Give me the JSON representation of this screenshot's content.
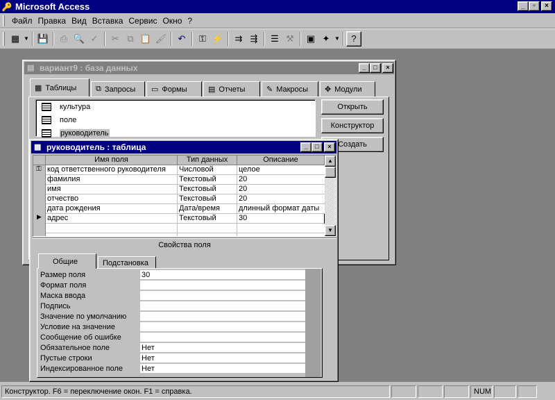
{
  "app": {
    "title": "Microsoft Access"
  },
  "menu": [
    "Файл",
    "Правка",
    "Вид",
    "Вставка",
    "Сервис",
    "Окно",
    "?"
  ],
  "db_window": {
    "title": "вариант9 : база данных",
    "tabs": [
      "Таблицы",
      "Запросы",
      "Формы",
      "Отчеты",
      "Макросы",
      "Модули"
    ],
    "objects": [
      "культура",
      "поле",
      "руководитель"
    ],
    "buttons": {
      "open": "Открыть",
      "design": "Конструктор",
      "create": "Создать"
    }
  },
  "table_window": {
    "title": "руководитель : таблица",
    "columns": [
      "Имя поля",
      "Тип данных",
      "Описание"
    ],
    "rows": [
      {
        "name": "код ответственного руководителя",
        "type": "Числовой",
        "desc": "целое"
      },
      {
        "name": "фамилия",
        "type": "Текстовый",
        "desc": "20"
      },
      {
        "name": "имя",
        "type": "Текстовый",
        "desc": "20"
      },
      {
        "name": "отчество",
        "type": "Текстовый",
        "desc": "20"
      },
      {
        "name": "дата рождения",
        "type": "Дата/время",
        "desc": "длинный формат даты"
      },
      {
        "name": "адрес",
        "type": "Текстовый",
        "desc": "30"
      }
    ],
    "field_properties_label": "Свойства поля",
    "prop_tabs": [
      "Общие",
      "Подстановка"
    ],
    "properties": [
      {
        "label": "Размер поля",
        "value": "30"
      },
      {
        "label": "Формат поля",
        "value": ""
      },
      {
        "label": "Маска ввода",
        "value": ""
      },
      {
        "label": "Подпись",
        "value": ""
      },
      {
        "label": "Значение по умолчанию",
        "value": ""
      },
      {
        "label": "Условие на значение",
        "value": ""
      },
      {
        "label": "Сообщение об ошибке",
        "value": ""
      },
      {
        "label": "Обязательное поле",
        "value": "Нет"
      },
      {
        "label": "Пустые строки",
        "value": "Нет"
      },
      {
        "label": "Индексированное поле",
        "value": "Нет"
      }
    ]
  },
  "status": {
    "text": "Конструктор.  F6 = переключение окон.  F1 = справка.",
    "num": "NUM"
  }
}
